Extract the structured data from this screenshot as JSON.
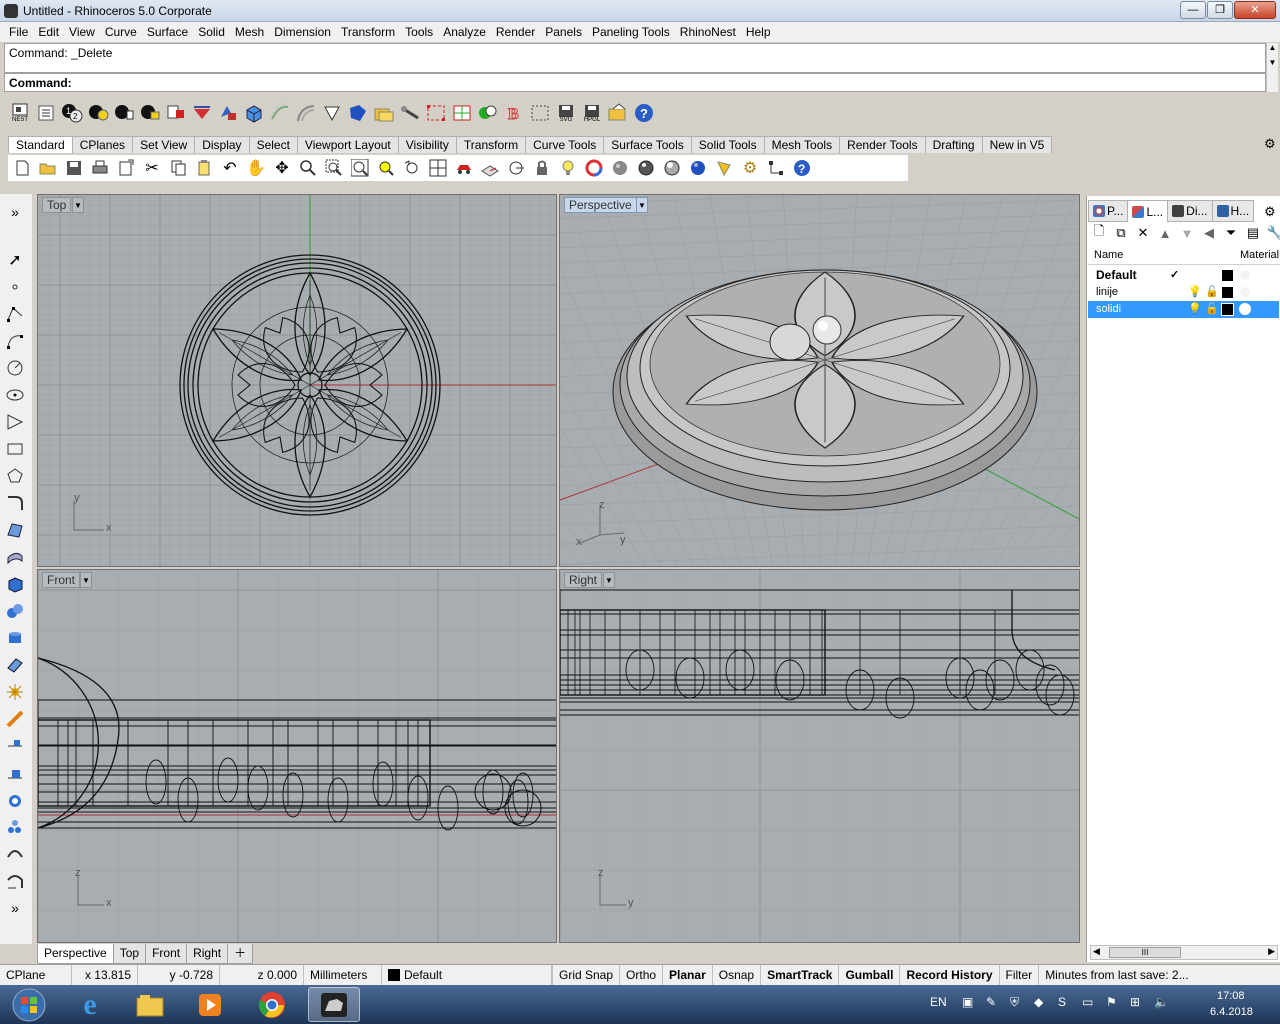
{
  "window": {
    "title": "Untitled - Rhinoceros  5.0 Corporate"
  },
  "menu": [
    "File",
    "Edit",
    "View",
    "Curve",
    "Surface",
    "Solid",
    "Mesh",
    "Dimension",
    "Transform",
    "Tools",
    "Analyze",
    "Render",
    "Panels",
    "Paneling Tools",
    "RhinoNest",
    "Help"
  ],
  "command": {
    "history": "Command: _Delete",
    "prompt": "Command:"
  },
  "toolbar1": {
    "nest_label": "NEST",
    "svg_label": "SVG",
    "hpgl_label": "HPGL"
  },
  "tabs": [
    "Standard",
    "CPlanes",
    "Set View",
    "Display",
    "Select",
    "Viewport Layout",
    "Visibility",
    "Transform",
    "Curve Tools",
    "Surface Tools",
    "Solid Tools",
    "Mesh Tools",
    "Render Tools",
    "Drafting",
    "New in V5"
  ],
  "viewports": {
    "top": {
      "label": "Top",
      "axis_a": "y",
      "axis_b": "x"
    },
    "perspective": {
      "label": "Perspective",
      "axis_a": "z",
      "axis_b": "x",
      "axis_c": "y"
    },
    "front": {
      "label": "Front",
      "axis_a": "z",
      "axis_b": "x"
    },
    "right": {
      "label": "Right",
      "axis_a": "z",
      "axis_b": "y"
    }
  },
  "viewport_tabs": [
    "Perspective",
    "Top",
    "Front",
    "Right"
  ],
  "left_toolbar_more": "»",
  "panel": {
    "tabs": [
      {
        "label": "P...",
        "color": "#c04040"
      },
      {
        "label": "L...",
        "color": "#d04848"
      },
      {
        "label": "Di...",
        "color": "#404040"
      },
      {
        "label": "H...",
        "color": "#3060a0"
      }
    ],
    "columns": {
      "name": "Name",
      "material": "Material"
    },
    "layers": [
      {
        "name": "Default",
        "current": true,
        "check": "✓",
        "selected": false
      },
      {
        "name": "linije",
        "current": false,
        "check": "",
        "selected": false
      },
      {
        "name": "solidi",
        "current": false,
        "check": "",
        "selected": true
      }
    ],
    "scroll_thumb": "III"
  },
  "status": {
    "cplane": "CPlane",
    "x": "x 13.815",
    "y": "y -0.728",
    "z": "z 0.000",
    "units": "Millimeters",
    "layer": "Default",
    "grid_snap": "Grid Snap",
    "ortho": "Ortho",
    "planar": "Planar",
    "osnap": "Osnap",
    "smarttrack": "SmartTrack",
    "gumball": "Gumball",
    "record_history": "Record History",
    "filter": "Filter",
    "autosave": "Minutes from last save: 2..."
  },
  "taskbar": {
    "lang": "EN",
    "time": "17:08",
    "date": "6.4.2018"
  },
  "colors": {
    "viewport_bg": "#a8adb2",
    "selection": "#3399ff",
    "x_axis": "#b03030",
    "y_axis": "#30a030"
  }
}
